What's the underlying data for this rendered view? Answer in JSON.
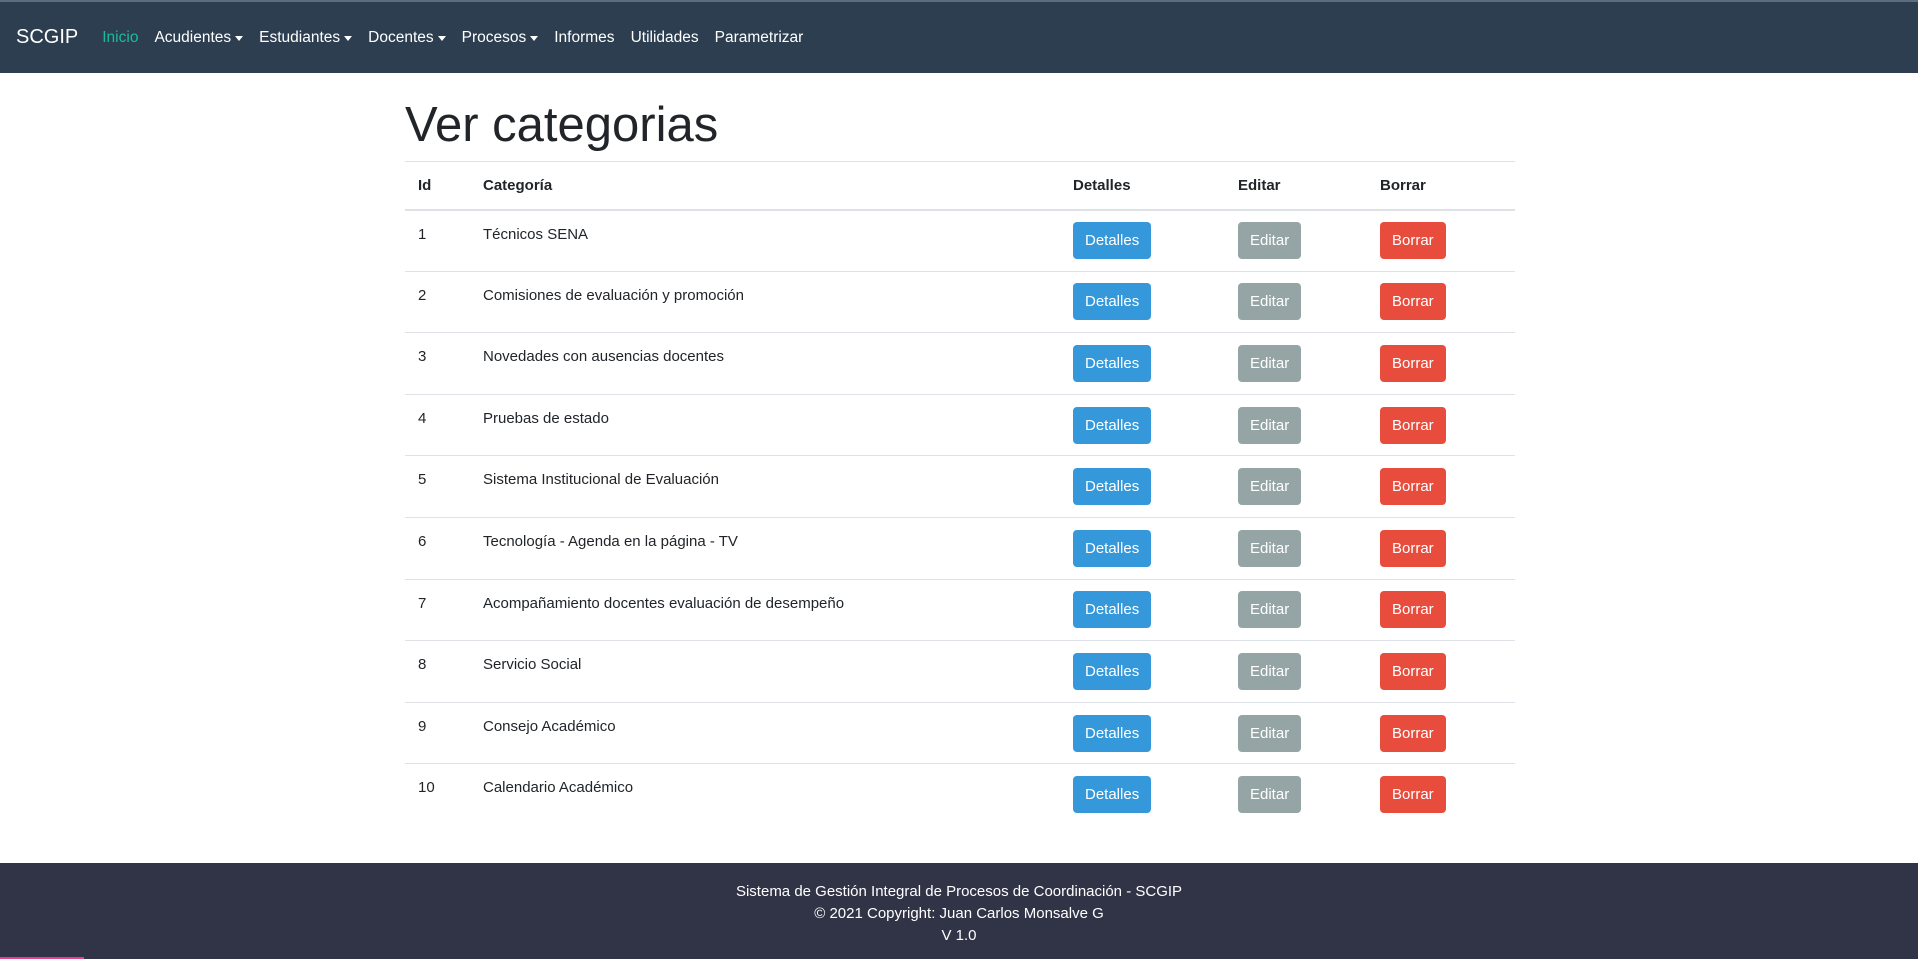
{
  "nav": {
    "brand": "SCGIP",
    "items": [
      {
        "label": "Inicio",
        "dropdown": false,
        "active": true
      },
      {
        "label": "Acudientes",
        "dropdown": true
      },
      {
        "label": "Estudiantes",
        "dropdown": true
      },
      {
        "label": "Docentes",
        "dropdown": true
      },
      {
        "label": "Procesos",
        "dropdown": true
      },
      {
        "label": "Informes",
        "dropdown": false
      },
      {
        "label": "Utilidades",
        "dropdown": false
      },
      {
        "label": "Parametrizar",
        "dropdown": false
      }
    ]
  },
  "page": {
    "title": "Ver categorias"
  },
  "table": {
    "headers": [
      "Id",
      "Categoría",
      "Detalles",
      "Editar",
      "Borrar"
    ],
    "rows": [
      {
        "id": "1",
        "name": "Técnicos SENA"
      },
      {
        "id": "2",
        "name": "Comisiones de evaluación y promoción"
      },
      {
        "id": "3",
        "name": "Novedades con ausencias docentes"
      },
      {
        "id": "4",
        "name": "Pruebas de estado"
      },
      {
        "id": "5",
        "name": "Sistema Institucional de Evaluación"
      },
      {
        "id": "6",
        "name": "Tecnología - Agenda en la página - TV"
      },
      {
        "id": "7",
        "name": "Acompañamiento docentes evaluación de desempeño"
      },
      {
        "id": "8",
        "name": "Servicio Social"
      },
      {
        "id": "9",
        "name": "Consejo Académico"
      },
      {
        "id": "10",
        "name": "Calendario Académico"
      }
    ],
    "buttons": {
      "details": "Detalles",
      "edit": "Editar",
      "delete": "Borrar"
    }
  },
  "footer": {
    "line1": "Sistema de Gestión Integral de Procesos de Coordinación - SCGIP",
    "line2": "© 2021 Copyright: Juan Carlos Monsalve G",
    "line3": "V 1.0"
  },
  "colors": {
    "navbar": "#2c3e50",
    "active_link": "#18bc9c",
    "details_button": "#3498db",
    "edit_button": "#95a5a6",
    "delete_button": "#e74c3c",
    "footer": "#303446"
  }
}
